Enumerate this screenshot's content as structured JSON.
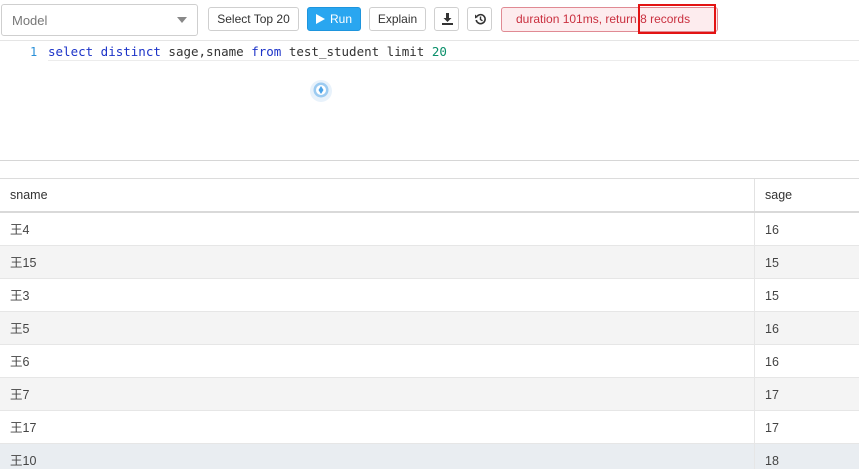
{
  "toolbar": {
    "model_select": {
      "value": "Model"
    },
    "select_top_label": "Select Top 20",
    "run_label": "Run",
    "explain_label": "Explain",
    "download_icon": "download-icon",
    "history_icon": "history-icon",
    "status_text": "duration 101ms, return 8 records"
  },
  "editor": {
    "line_number": "1",
    "code": {
      "kw1": "select distinct",
      "cols": " sage,sname ",
      "kw2": "from",
      "table": " test_student limit ",
      "num": "20"
    }
  },
  "table": {
    "columns": [
      "sname",
      "sage"
    ],
    "rows": [
      {
        "sname": "王4",
        "sage": "16"
      },
      {
        "sname": "王15",
        "sage": "15"
      },
      {
        "sname": "王3",
        "sage": "15"
      },
      {
        "sname": "王5",
        "sage": "16"
      },
      {
        "sname": "王6",
        "sage": "16"
      },
      {
        "sname": "王7",
        "sage": "17"
      },
      {
        "sname": "王17",
        "sage": "17"
      },
      {
        "sname": "王10",
        "sage": "18"
      }
    ]
  },
  "colors": {
    "run_button": "#29a6f0",
    "status_text": "#c9303f",
    "status_bg": "#fdecee",
    "highlight_box": "#e31313",
    "keyword": "#1c33c8",
    "number": "#0a8f6a"
  }
}
